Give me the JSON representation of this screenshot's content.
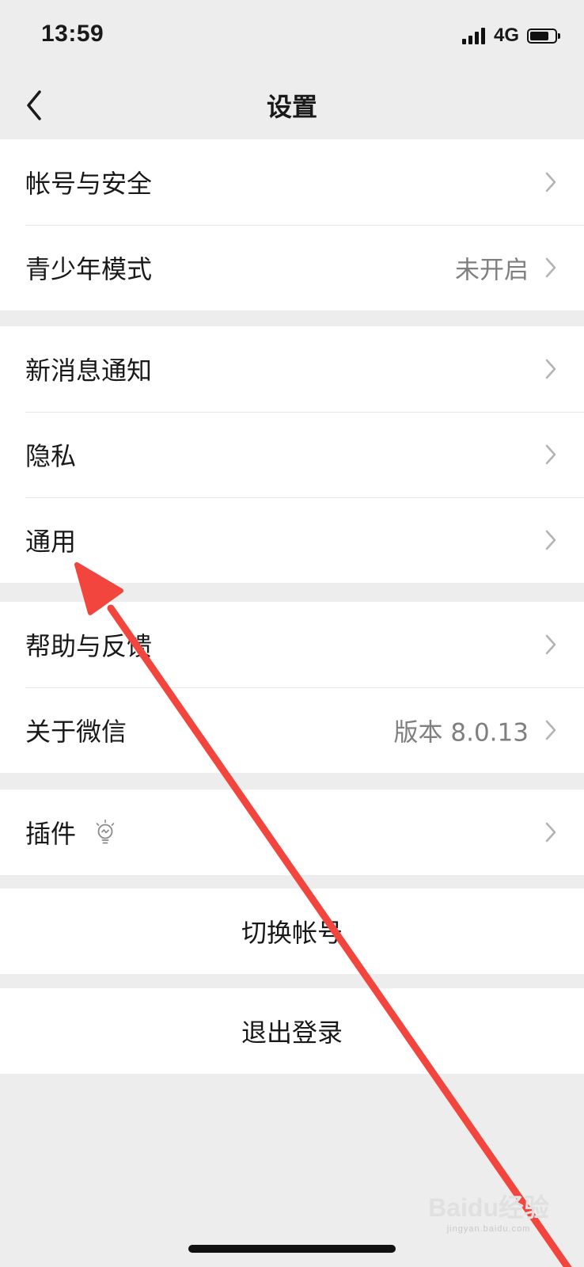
{
  "status_bar": {
    "time": "13:59",
    "network": "4G",
    "icons": [
      "signal-icon",
      "battery-icon"
    ]
  },
  "nav": {
    "title": "设置",
    "back_icon": "chevron-left-icon"
  },
  "groups": [
    {
      "items": [
        {
          "label": "帐号与安全",
          "value": ""
        },
        {
          "label": "青少年模式",
          "value": "未开启"
        }
      ]
    },
    {
      "items": [
        {
          "label": "新消息通知",
          "value": ""
        },
        {
          "label": "隐私",
          "value": ""
        },
        {
          "label": "通用",
          "value": ""
        }
      ]
    },
    {
      "items": [
        {
          "label": "帮助与反馈",
          "value": ""
        },
        {
          "label": "关于微信",
          "value": "版本 8.0.13"
        }
      ]
    },
    {
      "items": [
        {
          "label": "插件",
          "value": "",
          "icon": "lightbulb-icon"
        }
      ]
    }
  ],
  "actions": {
    "switch_account": "切换帐号",
    "logout": "退出登录"
  },
  "annotation": {
    "arrow_color": "#f2453d",
    "arrow_target": "通用"
  },
  "watermark": {
    "text": "Baidu经验",
    "sub": "jingyan.baidu.com"
  },
  "colors": {
    "background": "#ededed",
    "cell": "#ffffff",
    "secondary_text": "#7f7f7f"
  }
}
